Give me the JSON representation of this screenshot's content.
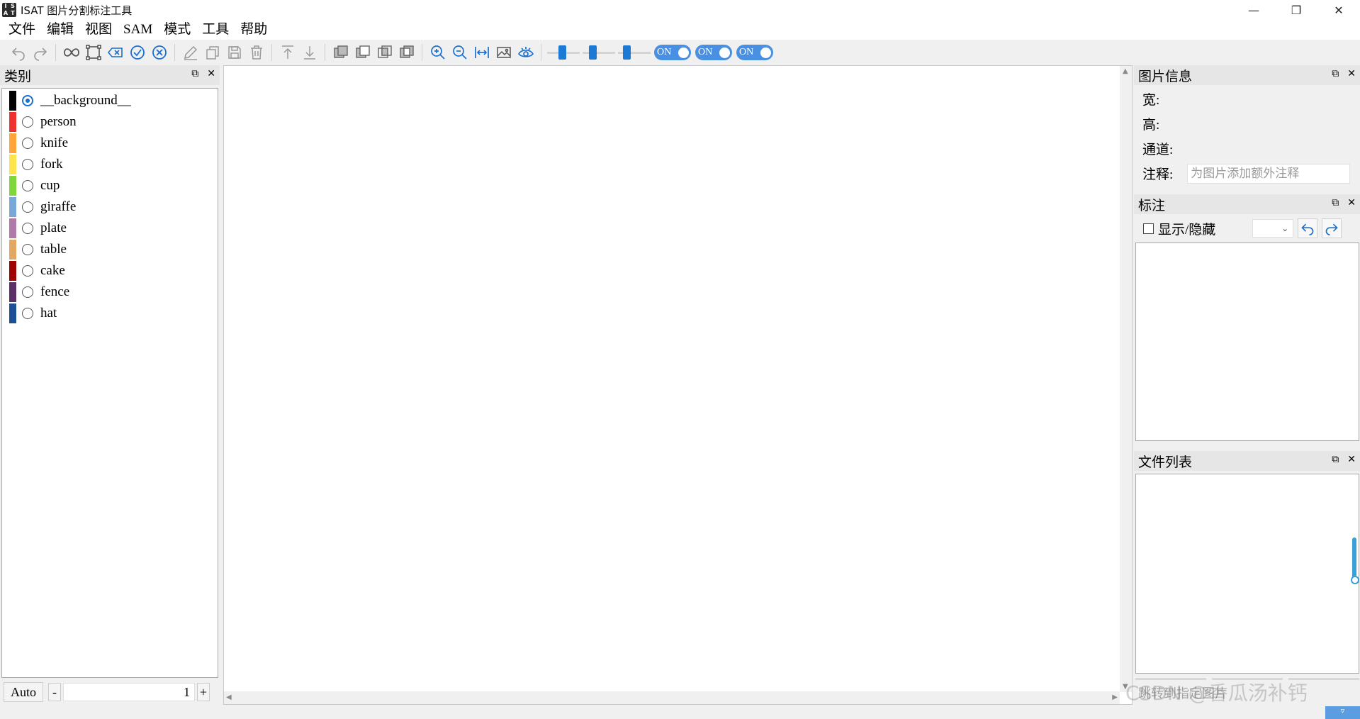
{
  "window": {
    "icon_letters": [
      "I",
      "S",
      "A",
      "T"
    ],
    "title": "ISAT 图片分割标注工具",
    "minimize": "—",
    "maximize": "❐",
    "close": "✕"
  },
  "menu": [
    "文件",
    "编辑",
    "视图",
    "SAM",
    "模式",
    "工具",
    "帮助"
  ],
  "toolbar": {
    "toggles": [
      "ON",
      "ON",
      "ON"
    ],
    "slider_levels": [
      0.45,
      0.25,
      0.2
    ],
    "accent_color": "#1a7ad4"
  },
  "categories_dock": {
    "title": "类别",
    "float_icon": "⧉",
    "close_icon": "✕",
    "items": [
      {
        "label": "__background__",
        "color": "#000000",
        "checked": true
      },
      {
        "label": "person",
        "color": "#ee3030",
        "checked": false
      },
      {
        "label": "knife",
        "color": "#ffa53a",
        "checked": false
      },
      {
        "label": "fork",
        "color": "#ffe34a",
        "checked": false
      },
      {
        "label": "cup",
        "color": "#7ed63a",
        "checked": false
      },
      {
        "label": "giraffe",
        "color": "#78a8d8",
        "checked": false
      },
      {
        "label": "plate",
        "color": "#b07aa8",
        "checked": false
      },
      {
        "label": "table",
        "color": "#e0a860",
        "checked": false
      },
      {
        "label": "cake",
        "color": "#a00000",
        "checked": false
      },
      {
        "label": "fence",
        "color": "#5a2e66",
        "checked": false
      },
      {
        "label": "hat",
        "color": "#1e4e98",
        "checked": false
      }
    ],
    "auto_button": "Auto",
    "minus": "-",
    "plus": "+",
    "number_value": "1"
  },
  "image_info": {
    "title": "图片信息",
    "width_label": "宽:",
    "height_label": "高:",
    "channel_label": "通道:",
    "note_label": "注释:",
    "note_placeholder": "为图片添加额外注释"
  },
  "annotations": {
    "title": "标注",
    "show_hide_label": "显示/隐藏"
  },
  "file_list": {
    "title": "文件列表",
    "jump_placeholder": "跳转到指定图片"
  },
  "watermark": "CSDN @香瓜汤补钙",
  "status": {
    "corner_text": "▿"
  }
}
